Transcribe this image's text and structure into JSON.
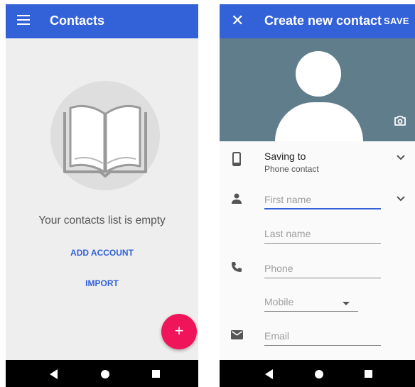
{
  "contacts_screen": {
    "title": "Contacts",
    "empty_message": "Your contacts list is empty",
    "add_account_label": "ADD ACCOUNT",
    "import_label": "IMPORT",
    "fab_label": "+"
  },
  "create_contact_screen": {
    "close_label": "✕",
    "title": "Create new contact",
    "save_label": "SAVE",
    "saving_to_label": "Saving to",
    "saving_to_value": "Phone contact",
    "first_name_placeholder": "First name",
    "last_name_placeholder": "Last name",
    "phone_placeholder": "Phone",
    "phone_type_selected": "Mobile",
    "email_placeholder": "Email"
  },
  "colors": {
    "app_bar": "#3361d8",
    "fab": "#f0155b",
    "photo_background": "#607d8b",
    "accent": "#3361d8"
  },
  "icons": [
    "menu-icon",
    "book-icon",
    "add-icon",
    "close-icon",
    "camera-icon",
    "phone-device-icon",
    "person-icon",
    "phone-icon",
    "email-icon",
    "chevron-down-icon",
    "back-icon",
    "home-icon",
    "recents-icon"
  ]
}
